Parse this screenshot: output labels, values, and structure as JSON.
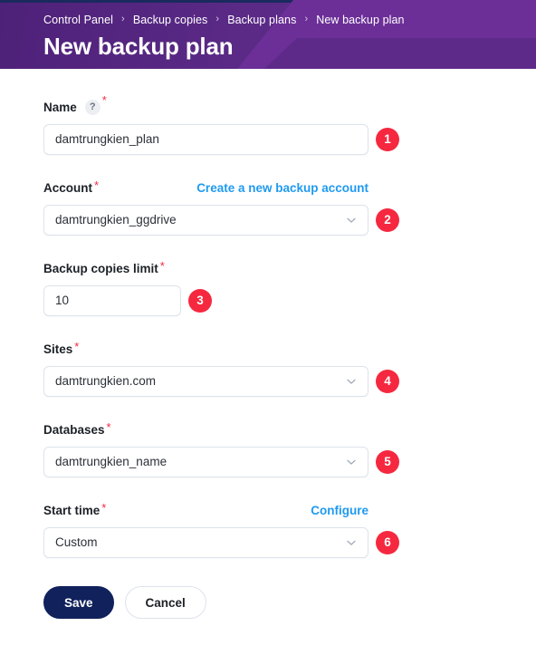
{
  "header": {
    "breadcrumb": [
      {
        "label": "Control Panel"
      },
      {
        "label": "Backup copies"
      },
      {
        "label": "Backup plans"
      },
      {
        "label": "New backup plan"
      }
    ],
    "separator": "›",
    "title": "New backup plan",
    "colors": {
      "gradient_start": "#4e2179",
      "gradient_end": "#6a2f95",
      "top_strip": "#1b2a5e"
    }
  },
  "form": {
    "required_mark": "*",
    "help_icon_label": "?",
    "chevron_icon": "chevron-down-icon",
    "fields": {
      "name": {
        "label": "Name",
        "required": true,
        "has_help": true,
        "value": "damtrungkien_plan",
        "placeholder": "Name",
        "marker": "1"
      },
      "account": {
        "label": "Account",
        "required": true,
        "link_label": "Create a new backup account",
        "value": "damtrungkien_ggdrive",
        "marker": "2"
      },
      "backup_copies_limit": {
        "label": "Backup copies limit",
        "required": true,
        "value": "10",
        "placeholder": "10",
        "marker": "3"
      },
      "sites": {
        "label": "Sites",
        "required": true,
        "value": "damtrungkien.com",
        "marker": "4"
      },
      "databases": {
        "label": "Databases",
        "required": true,
        "value": "damtrungkien_name",
        "marker": "5"
      },
      "start_time": {
        "label": "Start time",
        "required": true,
        "link_label": "Configure",
        "value": "Custom",
        "marker": "6"
      }
    },
    "buttons": {
      "save": "Save",
      "cancel": "Cancel"
    },
    "colors": {
      "link": "#1f9af0",
      "required": "#f5283f",
      "marker_badge": "#f5283f",
      "primary_button": "#10215c",
      "input_border": "#dde3ec"
    }
  }
}
